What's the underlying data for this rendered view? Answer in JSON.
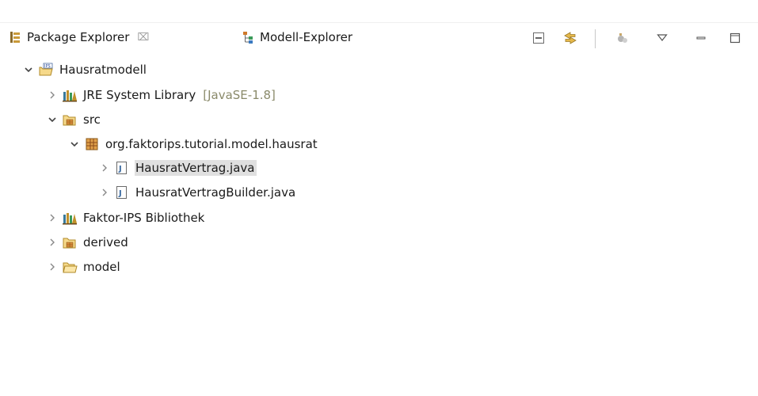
{
  "tabs": [
    {
      "label": "Package Explorer",
      "icon": "package-explorer-icon",
      "close": "⌧",
      "active": true
    },
    {
      "label": "Modell-Explorer",
      "icon": "model-explorer-icon",
      "active": false
    }
  ],
  "toolbar": [
    {
      "name": "collapse-all-icon"
    },
    {
      "name": "link-with-editor-icon"
    },
    {
      "name": "faktor-ips-icon"
    },
    {
      "name": "view-menu-icon"
    },
    {
      "name": "minimize-icon"
    },
    {
      "name": "maximize-icon"
    }
  ],
  "tree": [
    {
      "label": "Hausratmodell",
      "depth": 0,
      "expanded": true,
      "icon": "ips-project-icon"
    },
    {
      "label": "JRE System Library",
      "decoration": "[JavaSE-1.8]",
      "depth": 1,
      "expanded": false,
      "icon": "library-icon"
    },
    {
      "label": "src",
      "depth": 1,
      "expanded": true,
      "icon": "source-folder-icon"
    },
    {
      "label": "org.faktorips.tutorial.model.hausrat",
      "depth": 2,
      "expanded": true,
      "icon": "package-icon"
    },
    {
      "label": "HausratVertrag.java",
      "depth": 3,
      "expanded": false,
      "icon": "java-file-icon",
      "selected": true
    },
    {
      "label": "HausratVertragBuilder.java",
      "depth": 3,
      "expanded": false,
      "icon": "java-file-icon"
    },
    {
      "label": "Faktor-IPS Bibliothek",
      "depth": 1,
      "expanded": false,
      "icon": "library-icon"
    },
    {
      "label": "derived",
      "depth": 1,
      "expanded": false,
      "icon": "source-folder-icon"
    },
    {
      "label": "model",
      "depth": 1,
      "expanded": false,
      "icon": "folder-icon"
    }
  ],
  "colors": {
    "selection": "#e0e0e0",
    "decoration": "#8a8a6a",
    "twisty": "#555555"
  }
}
